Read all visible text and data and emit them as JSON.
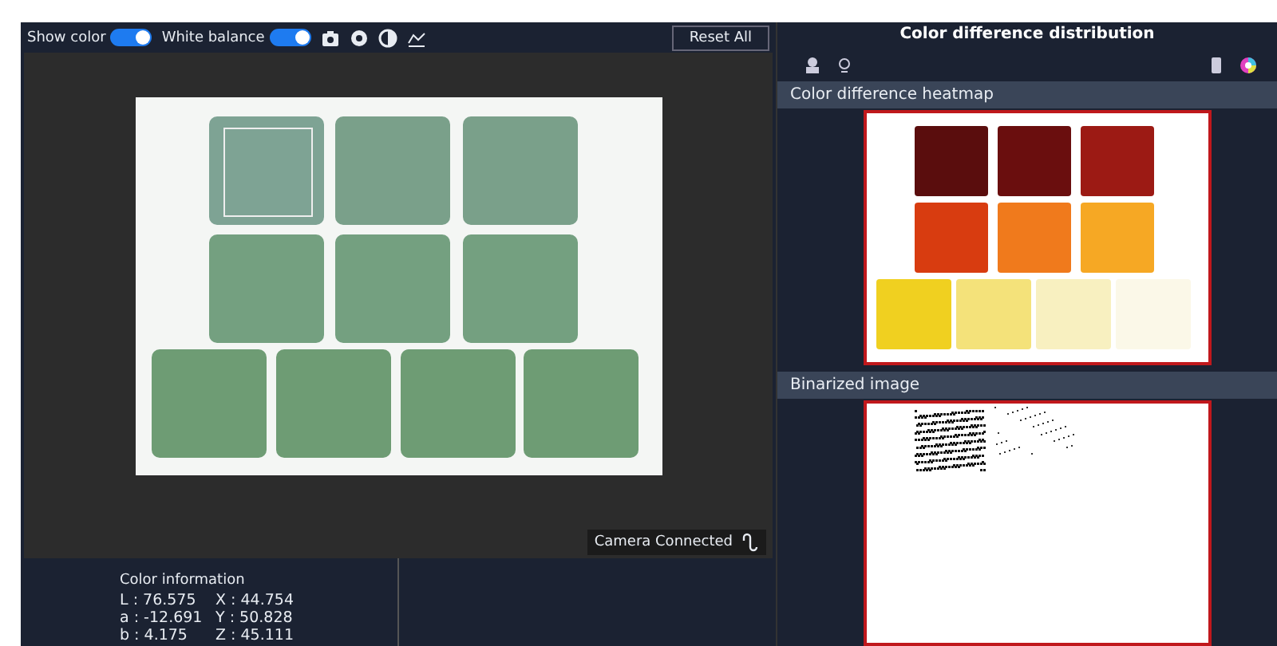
{
  "toolbar": {
    "toggles": [
      {
        "label": "Show color",
        "on": true
      },
      {
        "label": "White balance",
        "on": true
      }
    ],
    "reset_button": "Reset All"
  },
  "viewer": {
    "status": "Camera Connected"
  },
  "color_info": {
    "title": "Color information",
    "rows": [
      {
        "lab": "L : 76.575",
        "xyz": "X : 44.754"
      },
      {
        "lab": "a : -12.691",
        "xyz": "Y : 50.828"
      },
      {
        "lab": "b : 4.175",
        "xyz": "Z : 45.111"
      }
    ]
  },
  "right_panel": {
    "title": "Color difference distribution",
    "sections": [
      {
        "kind": "heatmap",
        "title": "Color difference heatmap"
      },
      {
        "kind": "binarized",
        "title": "Binarized image"
      }
    ]
  }
}
